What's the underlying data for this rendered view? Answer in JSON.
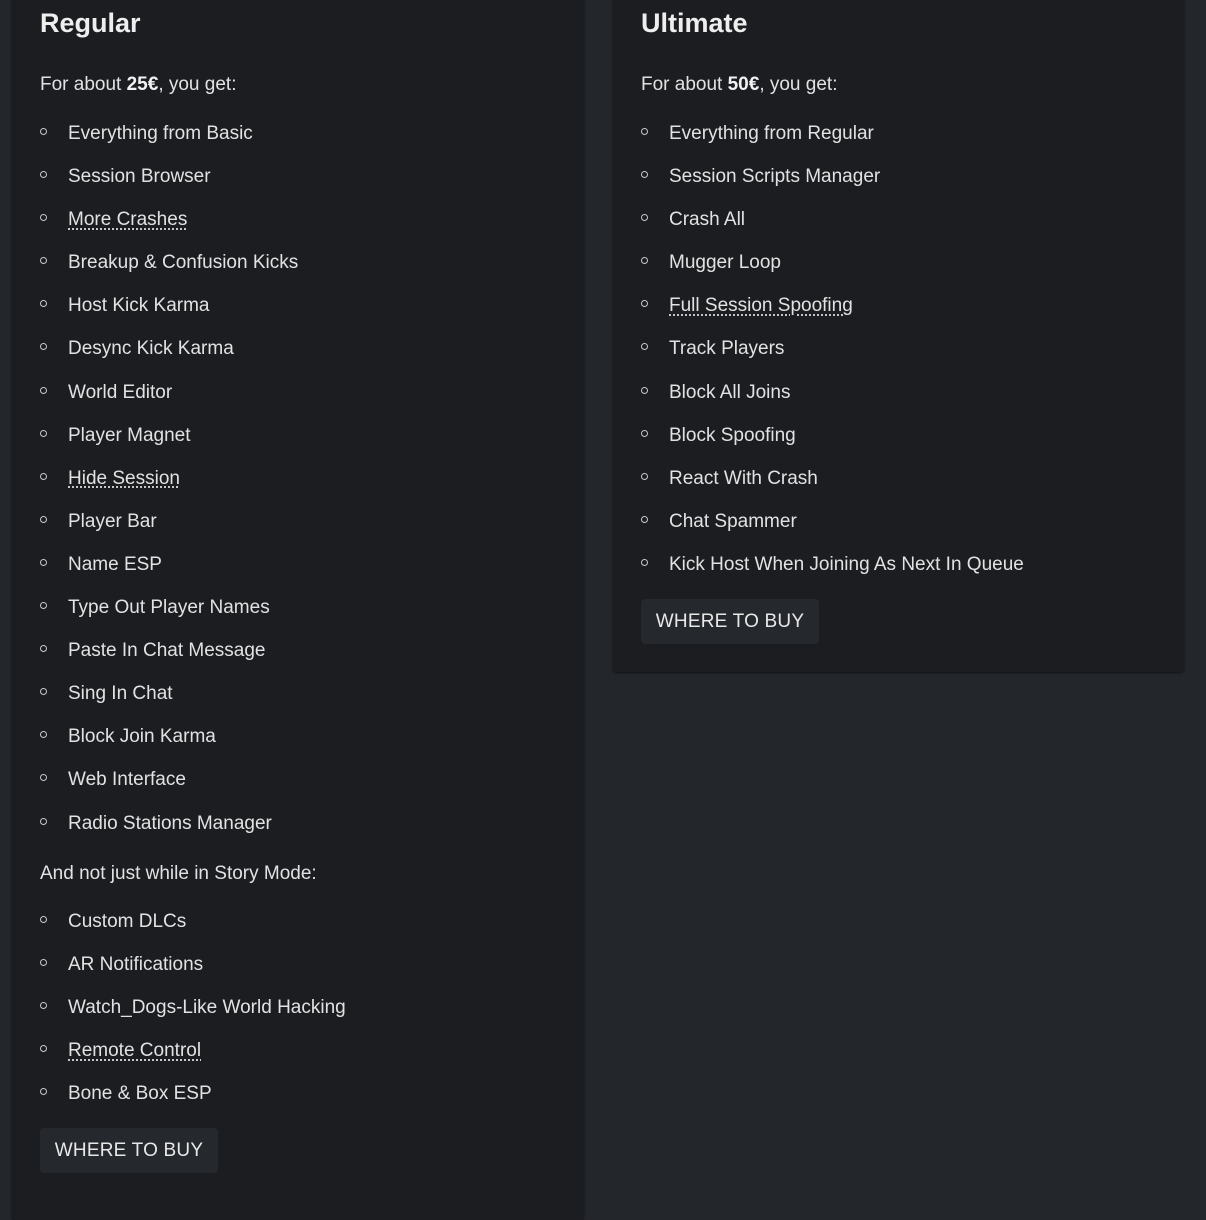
{
  "regular": {
    "title": "Regular",
    "intro_prefix": "For about ",
    "price": "25€",
    "intro_suffix": ", you get:",
    "features": [
      {
        "label": "Everything from Basic",
        "link": false
      },
      {
        "label": "Session Browser",
        "link": false
      },
      {
        "label": "More Crashes",
        "link": true
      },
      {
        "label": "Breakup & Confusion Kicks",
        "link": false
      },
      {
        "label": "Host Kick Karma",
        "link": false
      },
      {
        "label": "Desync Kick Karma",
        "link": false
      },
      {
        "label": "World Editor",
        "link": false
      },
      {
        "label": "Player Magnet",
        "link": false
      },
      {
        "label": "Hide Session",
        "link": true
      },
      {
        "label": "Player Bar",
        "link": false
      },
      {
        "label": "Name ESP",
        "link": false
      },
      {
        "label": "Type Out Player Names",
        "link": false
      },
      {
        "label": "Paste In Chat Message",
        "link": false
      },
      {
        "label": "Sing In Chat",
        "link": false
      },
      {
        "label": "Block Join Karma",
        "link": false
      },
      {
        "label": "Web Interface",
        "link": false
      },
      {
        "label": "Radio Stations Manager",
        "link": false
      }
    ],
    "story_mode_intro": "And not just while in Story Mode:",
    "story_features": [
      {
        "label": "Custom DLCs",
        "link": false
      },
      {
        "label": "AR Notifications",
        "link": false
      },
      {
        "label": "Watch_Dogs-Like World Hacking",
        "link": false
      },
      {
        "label": "Remote Control",
        "link": true
      },
      {
        "label": "Bone & Box ESP",
        "link": false
      }
    ],
    "buy_label": "WHERE TO BUY"
  },
  "ultimate": {
    "title": "Ultimate",
    "intro_prefix": "For about ",
    "price": "50€",
    "intro_suffix": ", you get:",
    "features": [
      {
        "label": "Everything from Regular",
        "link": false
      },
      {
        "label": "Session Scripts Manager",
        "link": false
      },
      {
        "label": "Crash All",
        "link": false
      },
      {
        "label": "Mugger Loop",
        "link": false
      },
      {
        "label": "Full Session Spoofing",
        "link": true
      },
      {
        "label": "Track Players",
        "link": false
      },
      {
        "label": "Block All Joins",
        "link": false
      },
      {
        "label": "Block Spoofing",
        "link": false
      },
      {
        "label": "React With Crash",
        "link": false
      },
      {
        "label": "Chat Spammer",
        "link": false
      },
      {
        "label": "Kick Host When Joining As Next In Queue",
        "link": false
      }
    ],
    "buy_label": "WHERE TO BUY"
  }
}
